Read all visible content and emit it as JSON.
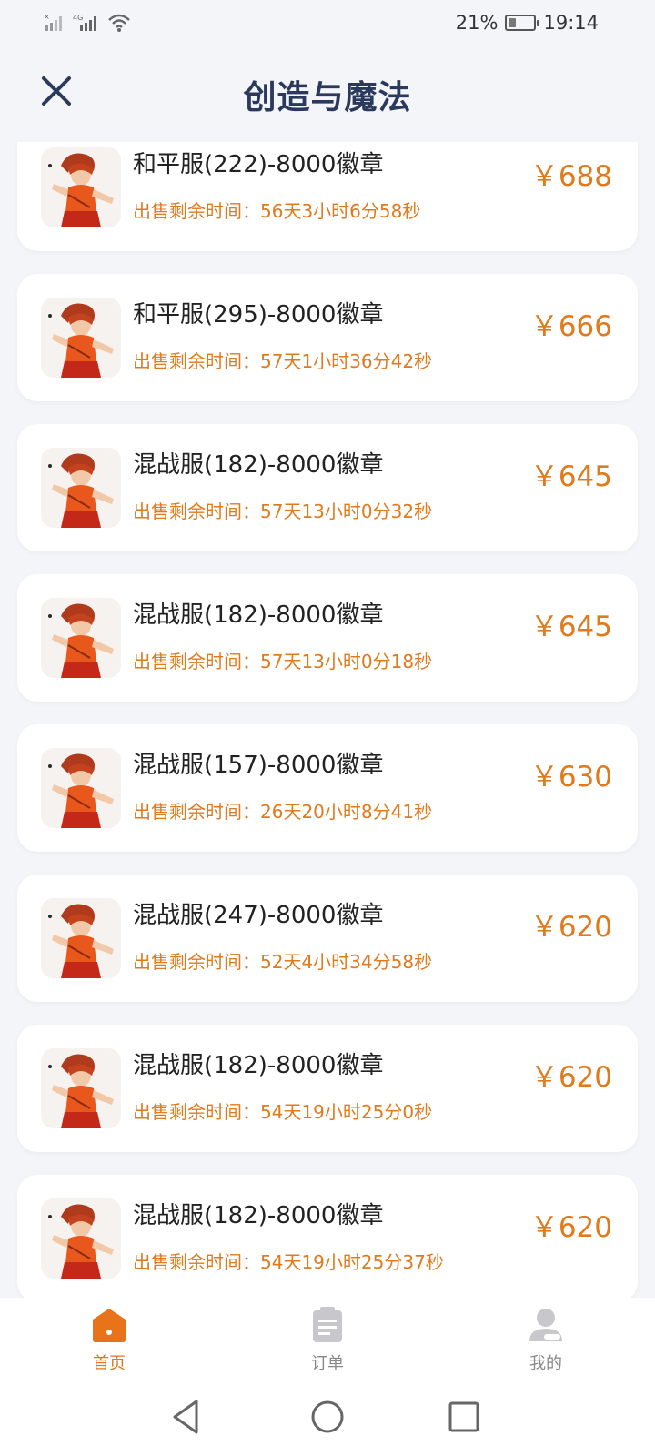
{
  "status_bar": {
    "battery_percent": "21%",
    "time": "19:14",
    "network_label": "4G"
  },
  "header": {
    "title": "创造与魔法",
    "close_icon": "close-icon"
  },
  "listings": [
    {
      "title": "和平服(222)-8000徽章",
      "countdown": "出售剩余时间：56天3小时6分58秒",
      "price": "￥688"
    },
    {
      "title": "和平服(295)-8000徽章",
      "countdown": "出售剩余时间：57天1小时36分42秒",
      "price": "￥666"
    },
    {
      "title": "混战服(182)-8000徽章",
      "countdown": "出售剩余时间：57天13小时0分32秒",
      "price": "￥645"
    },
    {
      "title": "混战服(182)-8000徽章",
      "countdown": "出售剩余时间：57天13小时0分18秒",
      "price": "￥645"
    },
    {
      "title": "混战服(157)-8000徽章",
      "countdown": "出售剩余时间：26天20小时8分41秒",
      "price": "￥630"
    },
    {
      "title": "混战服(247)-8000徽章",
      "countdown": "出售剩余时间：52天4小时34分58秒",
      "price": "￥620"
    },
    {
      "title": "混战服(182)-8000徽章",
      "countdown": "出售剩余时间：54天19小时25分0秒",
      "price": "￥620"
    },
    {
      "title": "混战服(182)-8000徽章",
      "countdown": "出售剩余时间：54天19小时25分37秒",
      "price": "￥620"
    }
  ],
  "bottom_nav": {
    "home": {
      "label": "首页",
      "icon": "home-icon"
    },
    "orders": {
      "label": "订单",
      "icon": "clipboard-icon"
    },
    "me": {
      "label": "我的",
      "icon": "user-icon"
    }
  },
  "colors": {
    "accent": "#e8731a",
    "price": "#e07a1c",
    "title": "#2b3a5c",
    "background": "#f3f5f9"
  }
}
